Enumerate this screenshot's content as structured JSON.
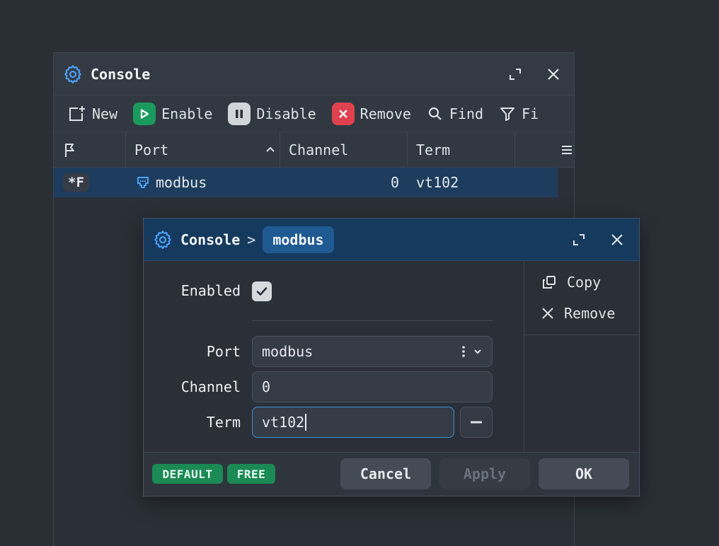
{
  "back_window": {
    "title": "Console",
    "toolbar": {
      "new_label": "New",
      "enable_label": "Enable",
      "disable_label": "Disable",
      "remove_label": "Remove",
      "find_label": "Find",
      "filter_label": "Fi"
    },
    "columns": {
      "port": "Port",
      "channel": "Channel",
      "term": "Term"
    },
    "row": {
      "flag": "*F",
      "port": "modbus",
      "channel": "0",
      "term": "vt102"
    }
  },
  "dialog": {
    "breadcrumb_root": "Console",
    "breadcrumb_sep": ">",
    "breadcrumb_current": "modbus",
    "form": {
      "enabled_label": "Enabled",
      "enabled": true,
      "port_label": "Port",
      "port_value": "modbus",
      "channel_label": "Channel",
      "channel_value": "0",
      "term_label": "Term",
      "term_value": "vt102"
    },
    "side_actions": {
      "copy_label": "Copy",
      "remove_label": "Remove"
    },
    "tags": [
      "DEFAULT",
      "FREE"
    ],
    "buttons": {
      "cancel": "Cancel",
      "apply": "Apply",
      "ok": "OK"
    }
  },
  "colors": {
    "accent_blue": "#3b8fdd",
    "enable_green": "#1b9a5e",
    "remove_red": "#e0414f",
    "tag_green": "#1b8a55",
    "selection": "#1e3d5e"
  }
}
